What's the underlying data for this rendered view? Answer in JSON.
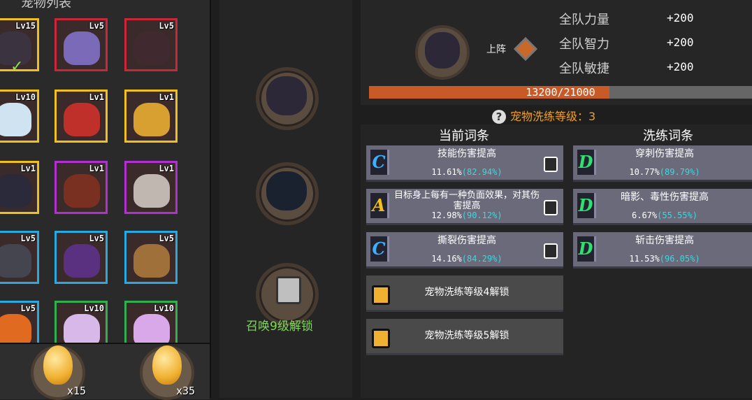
{
  "pet_list": {
    "title": "宠物列表",
    "pets": [
      {
        "level": "Lv15",
        "border": "#f0c020",
        "color": "#3b3340",
        "selected": true
      },
      {
        "level": "Lv5",
        "border": "#c8283a",
        "color": "#7a6ab8",
        "selected": false
      },
      {
        "level": "Lv5",
        "border": "#c8283a",
        "color": "#402a30",
        "selected": false
      },
      {
        "level": "Lv10",
        "border": "#f0c020",
        "color": "#cfe4f0",
        "selected": false
      },
      {
        "level": "Lv1",
        "border": "#f0c020",
        "color": "#c0302a",
        "selected": false
      },
      {
        "level": "Lv1",
        "border": "#f0c020",
        "color": "#d8a030",
        "selected": false
      },
      {
        "level": "Lv1",
        "border": "#f0c020",
        "color": "#2a2a3a",
        "selected": false
      },
      {
        "level": "Lv1",
        "border": "#b030d0",
        "color": "#7a3020",
        "selected": false
      },
      {
        "level": "Lv1",
        "border": "#b030d0",
        "color": "#c0b8b0",
        "selected": false
      },
      {
        "level": "Lv5",
        "border": "#2aa8e0",
        "color": "#454550",
        "selected": false
      },
      {
        "level": "Lv5",
        "border": "#2aa8e0",
        "color": "#5a3080",
        "selected": false
      },
      {
        "level": "Lv5",
        "border": "#2aa8e0",
        "color": "#a0703a",
        "selected": false
      },
      {
        "level": "Lv5",
        "border": "#2aa8e0",
        "color": "#e06a20",
        "selected": false
      },
      {
        "level": "Lv10",
        "border": "#30b050",
        "color": "#d8b8e8",
        "selected": false
      },
      {
        "level": "Lv10",
        "border": "#30b050",
        "color": "#d8a8e8",
        "selected": false
      }
    ]
  },
  "eggs": [
    {
      "count": "x15"
    },
    {
      "count": "x35"
    }
  ],
  "summon": {
    "lock_label": "召唤9级解锁"
  },
  "stats": {
    "deploy_label": "上阵",
    "rows": [
      {
        "label": "全队力量",
        "value": "+200"
      },
      {
        "label": "全队智力",
        "value": "+200"
      },
      {
        "label": "全队敏捷",
        "value": "+200"
      }
    ],
    "exp_text": "13200/21000",
    "exp_fraction": 0.6286
  },
  "refine": {
    "label": "宠物洗练等级：",
    "level": "3"
  },
  "affixes": {
    "current_header": "当前词条",
    "refine_header": "洗练词条",
    "current": [
      {
        "grade": "C",
        "grade_color": "#3bb0ff",
        "name": "技能伤害提高",
        "value": "11.61%",
        "pct": "(82.94%)"
      },
      {
        "grade": "A",
        "grade_color": "#f0c020",
        "name": "目标身上每有一种负面效果，对其伤害提高",
        "value": "12.98%",
        "pct": "(90.12%)"
      },
      {
        "grade": "C",
        "grade_color": "#3bb0ff",
        "name": "撕裂伤害提高",
        "value": "14.16%",
        "pct": "(84.29%)"
      }
    ],
    "locked": [
      {
        "name": "宠物洗练等级4解锁"
      },
      {
        "name": "宠物洗练等级5解锁"
      }
    ],
    "refined": [
      {
        "grade": "D",
        "grade_color": "#30e070",
        "name": "穿刺伤害提高",
        "value": "10.77%",
        "pct": "(89.79%)"
      },
      {
        "grade": "D",
        "grade_color": "#30e070",
        "name": "暗影、毒性伤害提高",
        "value": "6.67%",
        "pct": "(55.55%)"
      },
      {
        "grade": "D",
        "grade_color": "#30e070",
        "name": "斩击伤害提高",
        "value": "11.53%",
        "pct": "(96.05%)"
      }
    ]
  }
}
